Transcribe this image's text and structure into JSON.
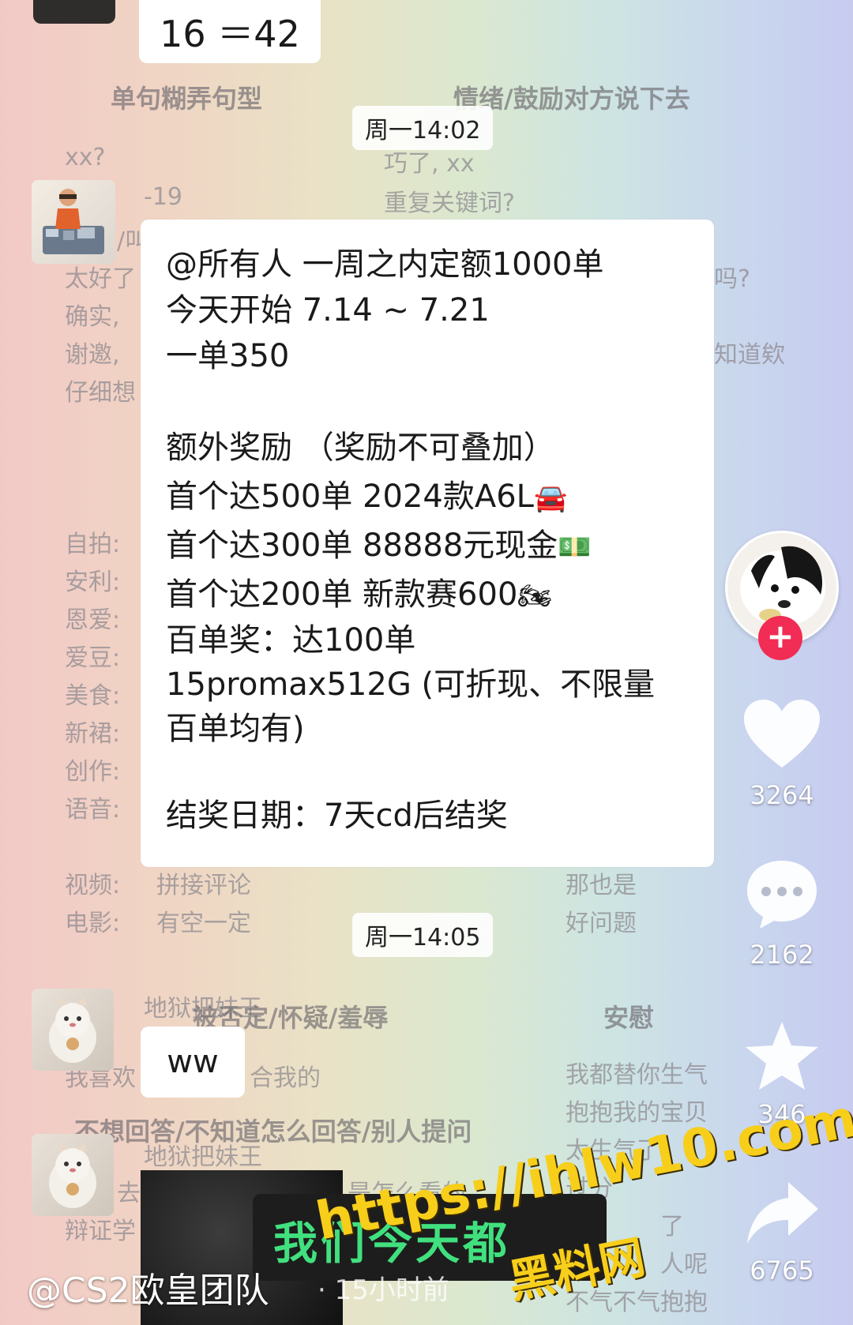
{
  "top_bubble": {
    "text": "16 ＝42"
  },
  "time_chips": [
    "周一14:02",
    "周一14:05"
  ],
  "background_chat": {
    "col_headers": [
      "单句糊弄句型",
      "情绪/鼓励对方说下去"
    ],
    "left_lines_top": [
      "xx?",
      "-19",
      "/叫",
      "太好了",
      "确实,",
      "谢邀,",
      "仔细想"
    ],
    "right_lines_top": [
      "巧了, xx",
      "重复关键词?"
    ],
    "right_fragments": [
      "吗?",
      "知道欸"
    ],
    "left_labels": [
      "自拍:",
      "安利:",
      "恩爱:",
      "爱豆:",
      "美食:",
      "新裙:",
      "创作:",
      "语音:",
      "视频:",
      "电影:"
    ],
    "mid_items": [
      "拼接评论",
      "有空一定"
    ],
    "right_items": [
      "那也是",
      "好问题"
    ],
    "lower_headers": [
      "地狱把妹王",
      "被否定/怀疑/羞辱",
      "安慰",
      "不想回答/不知道怎么回答/别人提问"
    ],
    "lower_left": [
      "我喜欢",
      "合我的",
      "去",
      "辩证学",
      "是怎么看的"
    ],
    "lower_right": [
      "我都替你生气",
      "抱抱我的宝贝",
      "太生气了",
      "过分",
      "了",
      "人呢",
      "不气不气抱抱"
    ]
  },
  "announcement": {
    "lines": [
      "@所有人 一周之内定额1000单",
      "今天开始 7.14 ~ 7.21",
      "一单350",
      "",
      "额外奖励 （奖励不可叠加）",
      "首个达500单  2024款A6L",
      "首个达300单 88888元现金",
      "首个达200单 新款赛600",
      "百单奖：达100单",
      "15promax512G (可折现、不限量",
      "百单均有)",
      "",
      "结奖日期：7天cd后结奖"
    ],
    "emojis": {
      "car": "🚘",
      "cash": "💵",
      "moto": "🏍"
    }
  },
  "ww_bubble": {
    "text": "ww"
  },
  "side_actions": {
    "likes": "3264",
    "comments": "2162",
    "favorites": "346",
    "shares": "6765",
    "follow_symbol": "+"
  },
  "video_caption_green": "我们今天都",
  "author": "@CS2欧皇团队",
  "post_time": "· 15小时前",
  "watermark": {
    "url": "https://ihlw10.com",
    "name": "黑料网"
  },
  "colors": {
    "follow_red": "#f12c55",
    "watermark_yellow": "#f7ce1a",
    "caption_green": "#41e07f"
  }
}
